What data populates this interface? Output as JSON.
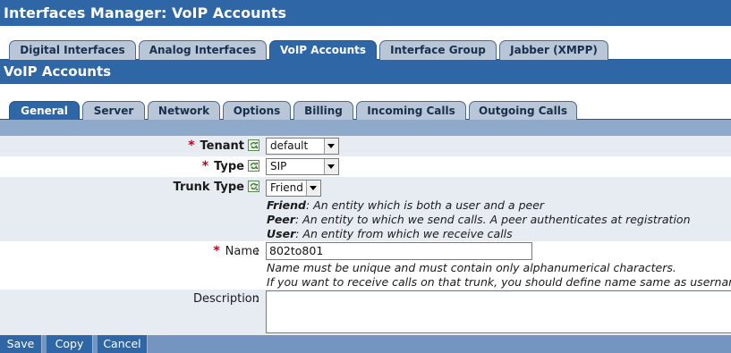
{
  "title": "Interfaces Manager:  VoIP Accounts",
  "main_tabs": [
    {
      "label": "Digital Interfaces",
      "active": false
    },
    {
      "label": "Analog Interfaces",
      "active": false
    },
    {
      "label": "VoIP Accounts",
      "active": true
    },
    {
      "label": "Interface Group",
      "active": false
    },
    {
      "label": "Jabber (XMPP)",
      "active": false
    }
  ],
  "section_title": "VoIP Accounts",
  "sub_tabs": [
    {
      "label": "General",
      "active": true
    },
    {
      "label": "Server",
      "active": false
    },
    {
      "label": "Network",
      "active": false
    },
    {
      "label": "Options",
      "active": false
    },
    {
      "label": "Billing",
      "active": false
    },
    {
      "label": "Incoming Calls",
      "active": false
    },
    {
      "label": "Outgoing Calls",
      "active": false
    }
  ],
  "form": {
    "required_mark": "*",
    "colon": ":",
    "tenant": {
      "label": "Tenant",
      "value": "default"
    },
    "type": {
      "label": "Type",
      "value": "SIP"
    },
    "trunk_type": {
      "label": "Trunk Type",
      "value": "Friend",
      "notes": [
        {
          "term": "Friend",
          "text": ": An entity which is both a user and a peer"
        },
        {
          "term": "Peer",
          "text": ": An entity to which we send calls. A peer authenticates at registration"
        },
        {
          "term": "User",
          "text": ": An entity from which we receive calls"
        }
      ]
    },
    "name": {
      "label": "Name",
      "value": "802to801",
      "notes": [
        "Name must be unique and must contain only alphanumerical characters.",
        "If you want to receive calls on that trunk, you should define name same as username"
      ]
    },
    "description": {
      "label": "Description",
      "value": ""
    }
  },
  "buttons": {
    "save": "Save",
    "copy": "Copy",
    "cancel": "Cancel"
  },
  "icons": {
    "help": "refresh-help-icon",
    "dropdown": "chevron-down-icon"
  },
  "colors": {
    "header_blue": "#2e66a6",
    "row_shade": "#e7ecf3",
    "required_red": "#c0001a"
  }
}
